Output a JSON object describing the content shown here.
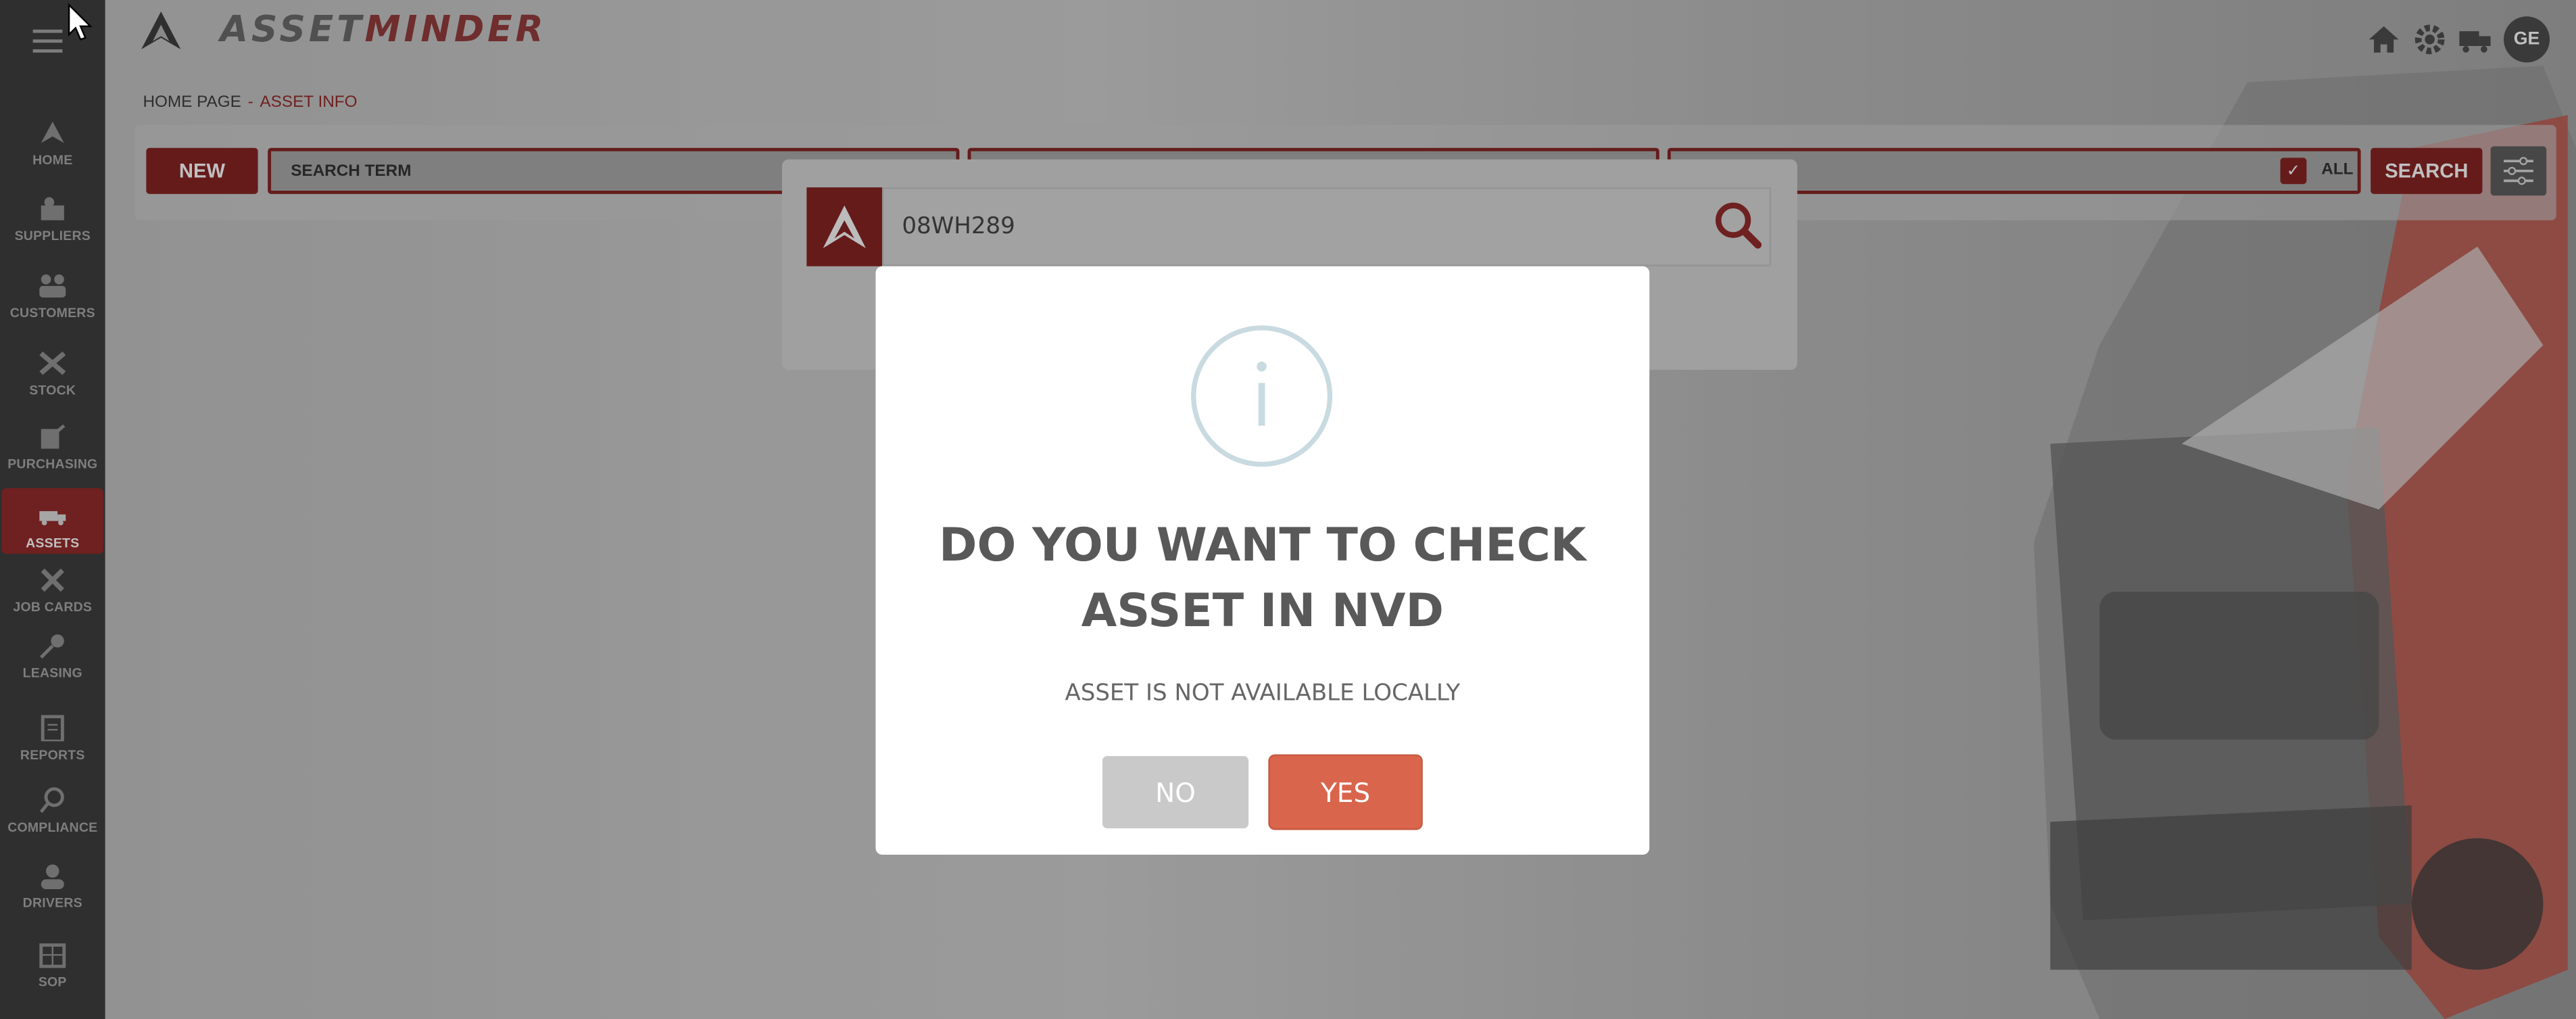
{
  "app": {
    "brand_part1": "ASSET",
    "brand_part2": "MINDER",
    "avatar_initials": "GE"
  },
  "sidebar": {
    "items": [
      {
        "label": "HOME",
        "icon": "home-icon"
      },
      {
        "label": "SUPPLIERS",
        "icon": "suppliers-icon"
      },
      {
        "label": "CUSTOMERS",
        "icon": "customers-icon"
      },
      {
        "label": "STOCK",
        "icon": "stock-icon"
      },
      {
        "label": "PURCHASING",
        "icon": "purchasing-icon"
      },
      {
        "label": "ASSETS",
        "icon": "truck-icon",
        "active": true
      },
      {
        "label": "JOB CARDS",
        "icon": "tools-icon"
      },
      {
        "label": "LEASING",
        "icon": "key-icon"
      },
      {
        "label": "REPORTS",
        "icon": "reports-icon"
      },
      {
        "label": "COMPLIANCE",
        "icon": "compliance-icon"
      },
      {
        "label": "DRIVERS",
        "icon": "driver-icon"
      },
      {
        "label": "SOP",
        "icon": "sop-icon"
      }
    ]
  },
  "breadcrumb": {
    "home": "HOME PAGE",
    "separator": "-",
    "current": "ASSET INFO"
  },
  "search_bar": {
    "new_label": "NEW",
    "search_term_placeholder": "SEARCH TERM",
    "all_label": "ALL",
    "all_checked": true,
    "search_label": "SEARCH"
  },
  "lookup": {
    "value": "08WH289"
  },
  "dialog": {
    "title_line1": "DO YOU WANT TO CHECK",
    "title_line2": "ASSET IN NVD",
    "message": "ASSET IS NOT AVAILABLE LOCALLY",
    "no_label": "NO",
    "yes_label": "YES"
  },
  "colors": {
    "brand_dark_red": "#6f1414",
    "sidebar_bg": "#2d2d2d",
    "yes_button": "#d9654c",
    "no_button": "#c9c9c9",
    "info_circle": "#c9dae1"
  }
}
